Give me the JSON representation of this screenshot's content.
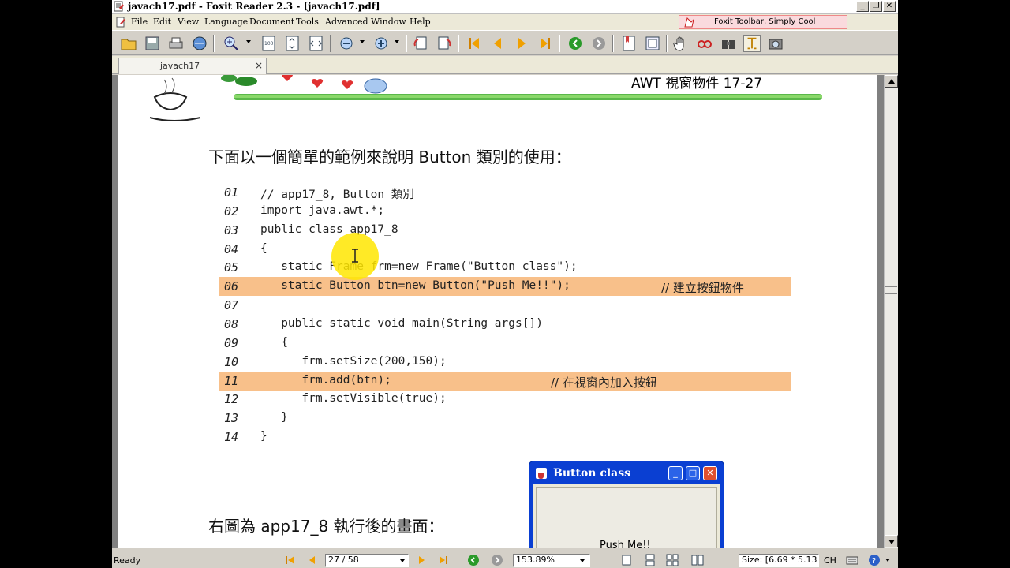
{
  "window": {
    "title": "javach17.pdf - Foxit Reader 2.3 - [javach17.pdf]",
    "minimize": "_",
    "restore": "❐",
    "close": "✕"
  },
  "menu": {
    "items": [
      "File",
      "Edit",
      "View",
      "Language",
      "Document",
      "Tools",
      "Advanced",
      "Window",
      "Help"
    ],
    "ad_text": "Foxit Toolbar, Simply Cool!"
  },
  "tabs": {
    "active_label": "javach17",
    "close_glyph": "×"
  },
  "page": {
    "header_title": "AWT 視窗物件   17-27",
    "intro": "下面以一個簡單的範例來說明 Button 類別的使用：",
    "code_lines": [
      {
        "num": "01",
        "code": "// app17_8, Button 類別",
        "comment": ""
      },
      {
        "num": "02",
        "code": "import java.awt.*;",
        "comment": ""
      },
      {
        "num": "03",
        "code": "public class app17_8",
        "comment": ""
      },
      {
        "num": "04",
        "code": "{",
        "comment": ""
      },
      {
        "num": "05",
        "code": "   static Frame frm=new Frame(\"Button class\");",
        "comment": ""
      },
      {
        "num": "06",
        "code": "   static Button btn=new Button(\"Push Me!!\");",
        "comment": "// 建立按鈕物件"
      },
      {
        "num": "07",
        "code": "",
        "comment": ""
      },
      {
        "num": "08",
        "code": "   public static void main(String args[])",
        "comment": ""
      },
      {
        "num": "09",
        "code": "   {",
        "comment": ""
      },
      {
        "num": "10",
        "code": "      frm.setSize(200,150);",
        "comment": ""
      },
      {
        "num": "11",
        "code": "      frm.add(btn);",
        "comment": "// 在視窗內加入按鈕"
      },
      {
        "num": "12",
        "code": "      frm.setVisible(true);",
        "comment": ""
      },
      {
        "num": "13",
        "code": "   }",
        "comment": ""
      },
      {
        "num": "14",
        "code": "}",
        "comment": ""
      }
    ],
    "caption": "右圖為 app17_8 執行後的畫面：",
    "demo_window_title": "Button class",
    "demo_button_label": "Push Me!!"
  },
  "status": {
    "ready": "Ready",
    "page_indicator": "27 / 58",
    "zoom": "153.89%",
    "size": "Size: [6.69 * 5.13",
    "lang": "CH"
  },
  "colors": {
    "highlight": "#f8c08a",
    "page_bg": "#ffffff",
    "xp_blue": "#0a3fd2"
  }
}
